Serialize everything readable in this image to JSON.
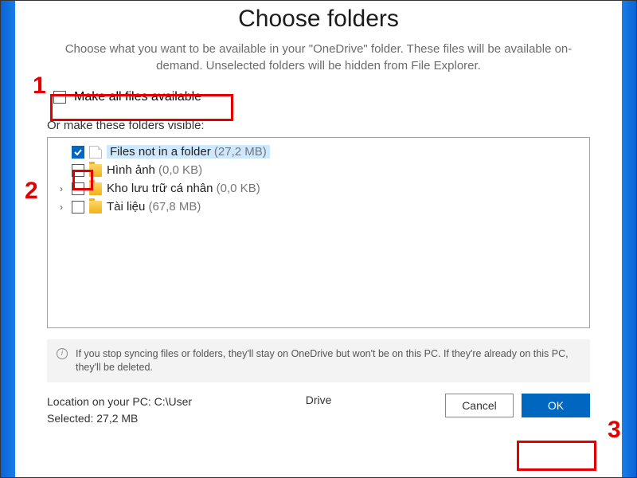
{
  "title": "Choose folders",
  "subtitle": "Choose what you want to be available in your \"OneDrive\" folder. These files will be available on-demand. Unselected folders will be hidden from File Explorer.",
  "make_all": {
    "label": "Make all files available",
    "checked": false
  },
  "section_label": "Or make these folders visible:",
  "tree": [
    {
      "expandable": false,
      "checked": true,
      "icon": "file",
      "label": "Files not in a folder",
      "size": "(27,2 MB)",
      "selected": true
    },
    {
      "expandable": false,
      "checked": false,
      "icon": "folder",
      "label": "Hình ảnh",
      "size": "(0,0 KB)",
      "selected": false
    },
    {
      "expandable": true,
      "checked": false,
      "icon": "folder",
      "label": "Kho lưu trữ cá nhân",
      "size": "(0,0 KB)",
      "selected": false
    },
    {
      "expandable": true,
      "checked": false,
      "icon": "folder",
      "label": "Tài liệu",
      "size": "(67,8 MB)",
      "selected": false
    }
  ],
  "info_text": "If you stop syncing files or folders, they'll stay on OneDrive but won't be on this PC. If they're already on this PC, they'll be deleted.",
  "footer": {
    "location_label": "Location on your PC: C:\\User",
    "drive_label": "Drive",
    "selected_label": "Selected: 27,2 MB",
    "cancel": "Cancel",
    "ok": "OK"
  },
  "annotations": {
    "n1": "1",
    "n2": "2",
    "n3": "3"
  }
}
